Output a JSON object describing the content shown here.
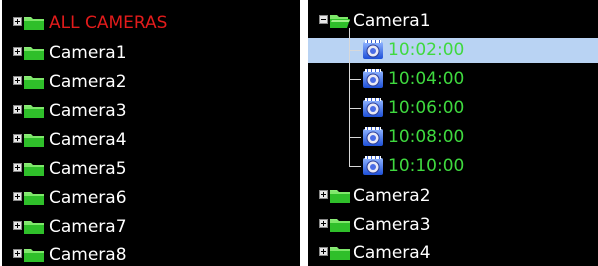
{
  "left_tree": {
    "items": [
      {
        "label": "ALL CAMERAS",
        "color": "#e21b1b"
      },
      {
        "label": "Camera1"
      },
      {
        "label": "Camera2"
      },
      {
        "label": "Camera3"
      },
      {
        "label": "Camera4"
      },
      {
        "label": "Camera5"
      },
      {
        "label": "Camera6"
      },
      {
        "label": "Camera7"
      },
      {
        "label": "Camera8"
      }
    ]
  },
  "right_tree": {
    "expanded_camera": "Camera1",
    "recordings": [
      {
        "time": "10:02:00",
        "selected": true
      },
      {
        "time": "10:04:00"
      },
      {
        "time": "10:06:00"
      },
      {
        "time": "10:08:00"
      },
      {
        "time": "10:10:00"
      }
    ],
    "other_cameras": [
      "Camera2",
      "Camera3",
      "Camera4"
    ],
    "recording_color": "#3fd93f",
    "selection_color": "#b9d3f3"
  },
  "icons": {
    "expander_collapsed": "plus-box-icon",
    "expander_expanded": "minus-box-icon",
    "folder": "folder-icon",
    "folder_open": "open-folder-icon",
    "recording": "camera-recording-icon"
  }
}
